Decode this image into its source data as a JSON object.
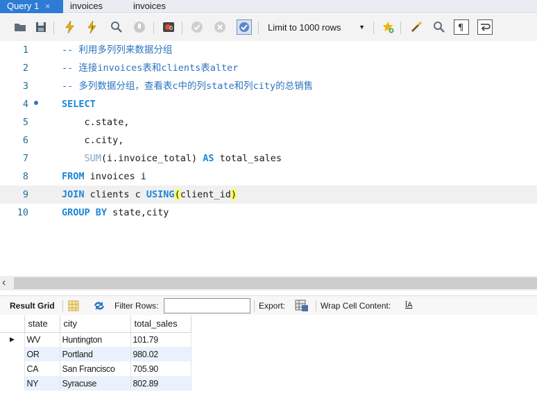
{
  "tabs": [
    {
      "label": "Query 1",
      "close": "×"
    },
    {
      "label": "invoices"
    },
    {
      "label": "invoices"
    }
  ],
  "toolbar": {
    "limit_label": "Limit to 1000 rows",
    "icons": [
      "open-folder-icon",
      "save-icon",
      "execute-icon",
      "execute-current-icon",
      "explain-icon",
      "stop-icon",
      "stop-on-error-icon",
      "commit-icon",
      "rollback-icon",
      "autocommit-icon",
      "limit-dropdown",
      "add-snippet-icon",
      "beautify-icon",
      "find-icon",
      "invisible-chars-icon",
      "wrap-icon"
    ]
  },
  "editor": {
    "lines": [
      {
        "n": "1",
        "parts": [
          {
            "t": "cm",
            "v": "-- 利用多列列来数据分组"
          }
        ]
      },
      {
        "n": "2",
        "parts": [
          {
            "t": "cm",
            "v": "-- 连接invoices表和clients表alter"
          }
        ]
      },
      {
        "n": "3",
        "parts": [
          {
            "t": "cm",
            "v": "-- 多列数据分组，查看表c中的列state和列city的总销售"
          }
        ]
      },
      {
        "n": "4",
        "dot": true,
        "parts": [
          {
            "t": "kw",
            "v": "SELECT"
          }
        ]
      },
      {
        "n": "5",
        "parts": [
          {
            "t": "tx",
            "v": "    c.state,"
          }
        ]
      },
      {
        "n": "6",
        "parts": [
          {
            "t": "tx",
            "v": "    c.city,"
          }
        ]
      },
      {
        "n": "7",
        "parts": [
          {
            "t": "tx",
            "v": "    "
          },
          {
            "t": "fn",
            "v": "SUM"
          },
          {
            "t": "tx",
            "v": "(i.invoice_total) "
          },
          {
            "t": "kw",
            "v": "AS"
          },
          {
            "t": "tx",
            "v": " total_sales"
          }
        ]
      },
      {
        "n": "8",
        "parts": [
          {
            "t": "kw",
            "v": "FROM"
          },
          {
            "t": "tx",
            "v": " invoices i"
          }
        ]
      },
      {
        "n": "9",
        "cur": true,
        "parts": [
          {
            "t": "kw",
            "v": "JOIN"
          },
          {
            "t": "tx",
            "v": " clients c "
          },
          {
            "t": "kw",
            "v": "USING"
          },
          {
            "t": "paren",
            "v": "("
          },
          {
            "t": "tx",
            "v": "client_id"
          },
          {
            "t": "paren",
            "v": ")"
          }
        ]
      },
      {
        "n": "10",
        "parts": [
          {
            "t": "kw",
            "v": "GROUP BY"
          },
          {
            "t": "tx",
            "v": " state,city"
          }
        ]
      }
    ]
  },
  "scroll": {
    "left_arrow": "‹"
  },
  "results": {
    "result_grid_label": "Result Grid",
    "filter_label": "Filter Rows:",
    "filter_value": "",
    "export_label": "Export:",
    "wrap_label": "Wrap Cell Content:",
    "wrap_icon_glyph": "ĪA"
  },
  "grid": {
    "columns": [
      "state",
      "city",
      "total_sales"
    ],
    "rows": [
      [
        "WV",
        "Huntington",
        "101.79"
      ],
      [
        "OR",
        "Portland",
        "980.02"
      ],
      [
        "CA",
        "San Francisco",
        "705.90"
      ],
      [
        "NY",
        "Syracuse",
        "802.89"
      ]
    ],
    "current_row_marker": "▶"
  }
}
